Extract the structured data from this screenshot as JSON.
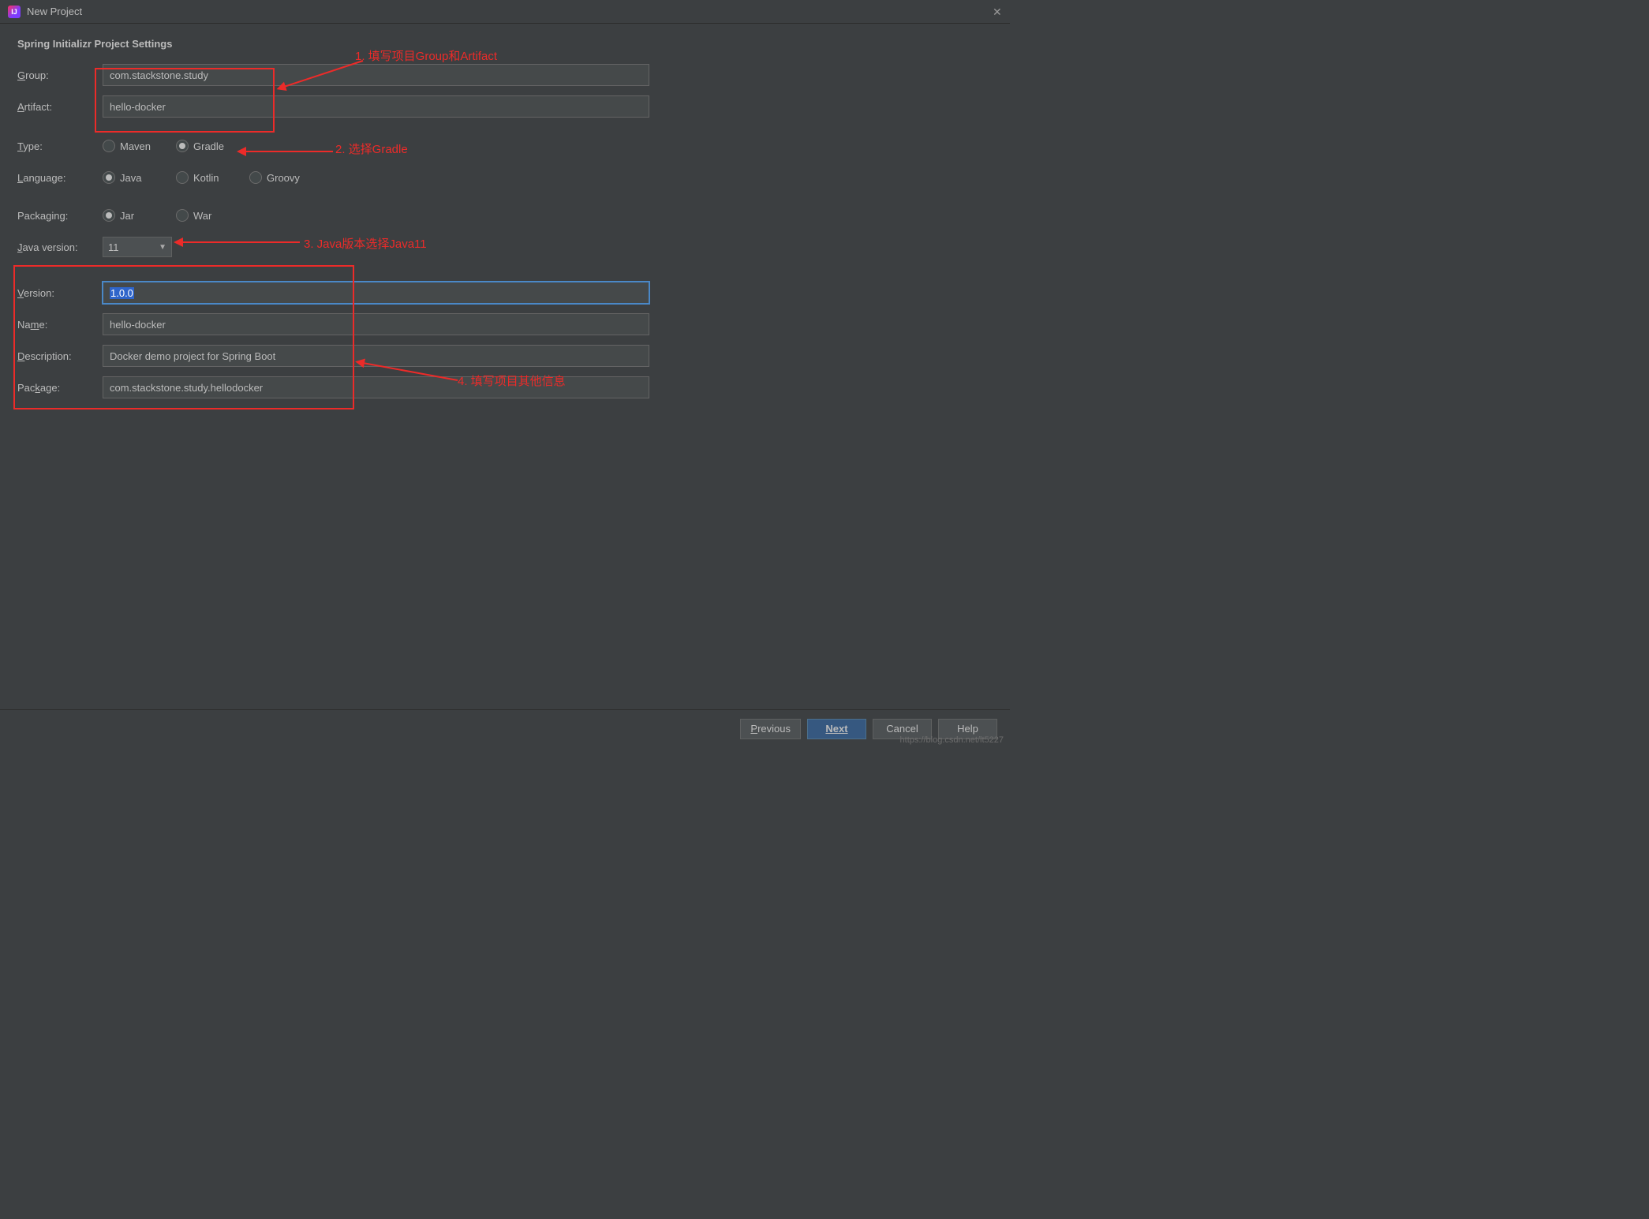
{
  "window": {
    "title": "New Project"
  },
  "section_title": "Spring Initializr Project Settings",
  "labels": {
    "group": "Group:",
    "artifact": "Artifact:",
    "type": "Type:",
    "language": "Language:",
    "packaging": "Packaging:",
    "java_version": "Java version:",
    "version": "Version:",
    "name": "Name:",
    "description": "Description:",
    "package": "Package:"
  },
  "fields": {
    "group": "com.stackstone.study",
    "artifact": "hello-docker",
    "version": "1.0.0",
    "name": "hello-docker",
    "description": "Docker demo project for Spring Boot",
    "package": "com.stackstone.study.hellodocker"
  },
  "radios": {
    "type": {
      "maven": "Maven",
      "gradle": "Gradle",
      "selected": "gradle"
    },
    "language": {
      "java": "Java",
      "kotlin": "Kotlin",
      "groovy": "Groovy",
      "selected": "java"
    },
    "packaging": {
      "jar": "Jar",
      "war": "War",
      "selected": "jar"
    }
  },
  "java_version_selected": "11",
  "buttons": {
    "previous": "Previous",
    "next": "Next",
    "cancel": "Cancel",
    "help": "Help"
  },
  "annotations": {
    "a1": "1. 填写项目Group和Artifact",
    "a2": "2. 选择Gradle",
    "a3": "3. Java版本选择Java11",
    "a4": "4. 填写项目其他信息"
  },
  "watermark": "https://blog.csdn.net/lt5227"
}
